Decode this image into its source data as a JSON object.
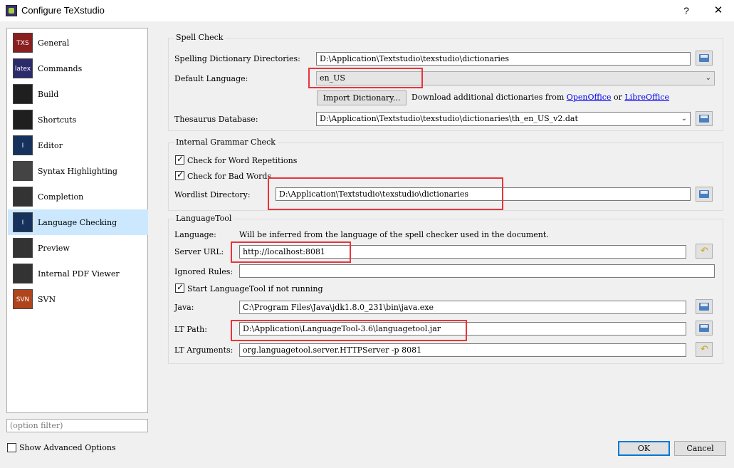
{
  "window": {
    "title": "Configure TeXstudio",
    "help": "?",
    "close": "✕"
  },
  "sidebar": {
    "items": [
      {
        "label": "General",
        "icon": "txs-icon",
        "icon_text": "TXS"
      },
      {
        "label": "Commands",
        "icon": "latex-icon",
        "icon_text": "latex"
      },
      {
        "label": "Build",
        "icon": "build-icon",
        "icon_text": ""
      },
      {
        "label": "Shortcuts",
        "icon": "keyboard-icon",
        "icon_text": ""
      },
      {
        "label": "Editor",
        "icon": "editor-icon",
        "icon_text": "I"
      },
      {
        "label": "Syntax Highlighting",
        "icon": "syntax-icon",
        "icon_text": ""
      },
      {
        "label": "Completion",
        "icon": "completion-icon",
        "icon_text": ""
      },
      {
        "label": "Language Checking",
        "icon": "language-icon",
        "icon_text": "I"
      },
      {
        "label": "Preview",
        "icon": "preview-icon",
        "icon_text": ""
      },
      {
        "label": "Internal PDF Viewer",
        "icon": "pdf-icon",
        "icon_text": ""
      },
      {
        "label": "SVN",
        "icon": "svn-icon",
        "icon_text": "SVN"
      }
    ],
    "filter_placeholder": "(option filter)",
    "show_advanced": "Show Advanced Options"
  },
  "spell": {
    "title": "Spell Check",
    "dict_label": "Spelling Dictionary Directories:",
    "dict_value": "D:\\Application\\Textstudio\\texstudio\\dictionaries",
    "lang_label": "Default Language:",
    "lang_value": "en_US",
    "import_button": "Import Dictionary...",
    "download_text": "Download additional dictionaries from",
    "openoffice": "OpenOffice",
    "or": "or",
    "libreoffice": "LibreOffice",
    "thes_label": "Thesaurus Database:",
    "thes_value": "D:\\Application\\Textstudio\\texstudio\\dictionaries\\th_en_US_v2.dat"
  },
  "grammar": {
    "title": "Internal Grammar Check",
    "repetitions": "Check for Word Repetitions",
    "bad_words": "Check for Bad Words",
    "wordlist_label": "Wordlist Directory:",
    "wordlist_value": "D:\\Application\\Textstudio\\texstudio\\dictionaries"
  },
  "lt": {
    "title": "LanguageTool",
    "language_label": "Language:",
    "language_text": "Will be inferred from the language of the spell checker used in the document.",
    "server_label": "Server URL:",
    "server_value": "http://localhost:8081",
    "ignored_label": "Ignored Rules:",
    "ignored_value": "",
    "start_label": "Start LanguageTool if not running",
    "java_label": "Java:",
    "java_value": "C:\\Program Files\\Java\\jdk1.8.0_231\\bin\\java.exe",
    "path_label": "LT Path:",
    "path_value": "D:\\Application\\LanguageTool-3.6\\languagetool.jar",
    "args_label": "LT Arguments:",
    "args_value": "org.languagetool.server.HTTPServer -p 8081"
  },
  "footer": {
    "ok": "OK",
    "cancel": "Cancel"
  },
  "colors": {
    "annotation": "#e8343a",
    "selection": "#cce8ff",
    "link": "#0000ee"
  }
}
